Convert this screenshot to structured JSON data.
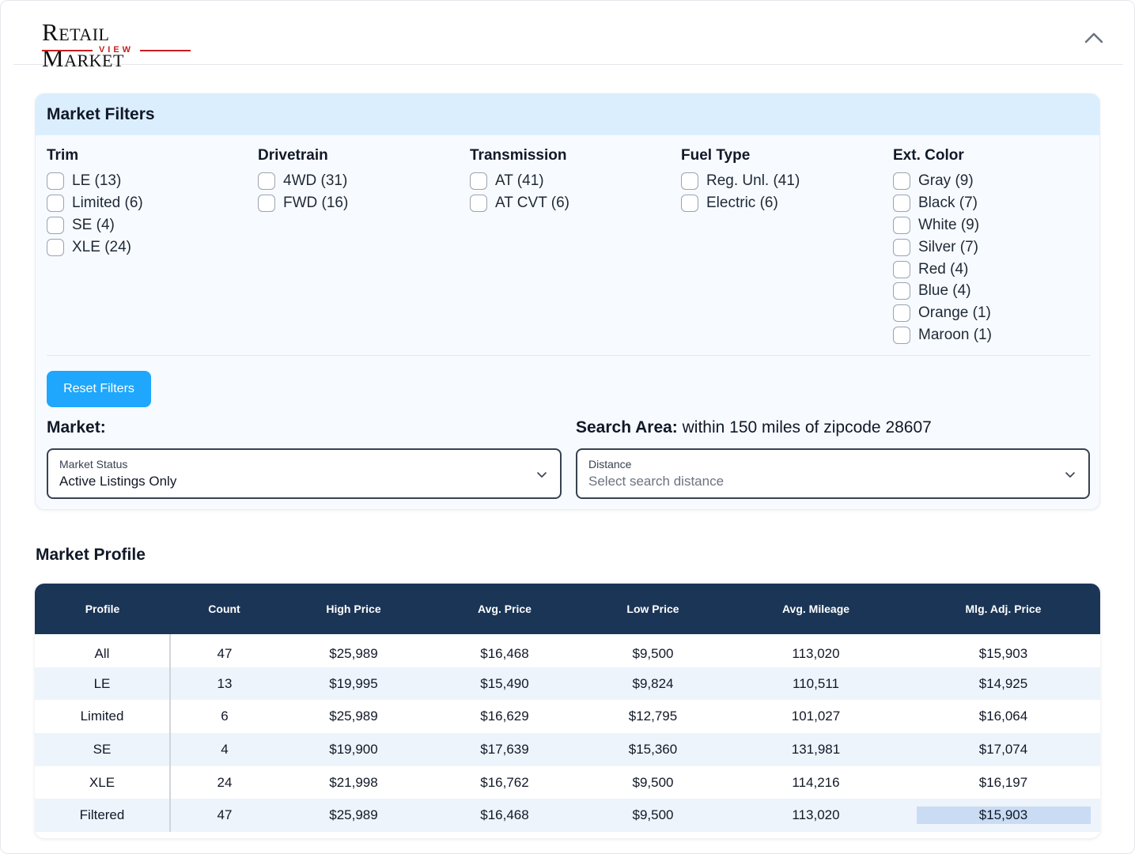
{
  "logo": {
    "main_r": "R",
    "main_etail": "ETAIL",
    "main_m": "M",
    "main_arket": "ARKET",
    "sub": "VIEW"
  },
  "filters": {
    "title": "Market Filters",
    "groups": [
      {
        "title": "Trim",
        "options": [
          "LE (13)",
          "Limited (6)",
          "SE (4)",
          "XLE (24)"
        ]
      },
      {
        "title": "Drivetrain",
        "options": [
          "4WD (31)",
          "FWD (16)"
        ]
      },
      {
        "title": "Transmission",
        "options": [
          "AT (41)",
          "AT CVT (6)"
        ]
      },
      {
        "title": "Fuel Type",
        "options": [
          "Reg. Unl. (41)",
          "Electric (6)"
        ]
      },
      {
        "title": "Ext. Color",
        "options": [
          "Gray (9)",
          "Black (7)",
          "White (9)",
          "Silver (7)",
          "Red (4)",
          "Blue (4)",
          "Orange (1)",
          "Maroon (1)"
        ]
      }
    ],
    "reset_label": "Reset Filters",
    "market_label": "Market:",
    "search_area_label": "Search Area:",
    "search_area_value": "within 150 miles of zipcode 28607",
    "market_select": {
      "label": "Market Status",
      "value": "Active Listings Only"
    },
    "distance_select": {
      "label": "Distance",
      "placeholder": "Select search distance"
    }
  },
  "profile": {
    "title": "Market Profile",
    "columns": [
      "Profile",
      "Count",
      "High Price",
      "Avg. Price",
      "Low Price",
      "Avg. Mileage",
      "Mlg. Adj. Price"
    ],
    "rows": [
      [
        "All",
        "47",
        "$25,989",
        "$16,468",
        "$9,500",
        "113,020",
        "$15,903"
      ],
      [
        "LE",
        "13",
        "$19,995",
        "$15,490",
        "$9,824",
        "110,511",
        "$14,925"
      ],
      [
        "Limited",
        "6",
        "$25,989",
        "$16,629",
        "$12,795",
        "101,027",
        "$16,064"
      ],
      [
        "SE",
        "4",
        "$19,900",
        "$17,639",
        "$15,360",
        "131,981",
        "$17,074"
      ],
      [
        "XLE",
        "24",
        "$21,998",
        "$16,762",
        "$9,500",
        "114,216",
        "$16,197"
      ],
      [
        "Filtered",
        "47",
        "$25,989",
        "$16,468",
        "$9,500",
        "113,020",
        "$15,903"
      ]
    ]
  },
  "colors": {
    "accent": "#1ea7fd",
    "header_bg": "#1b3556",
    "filter_head": "#dbeefd",
    "logo_red": "#c81e1e"
  }
}
